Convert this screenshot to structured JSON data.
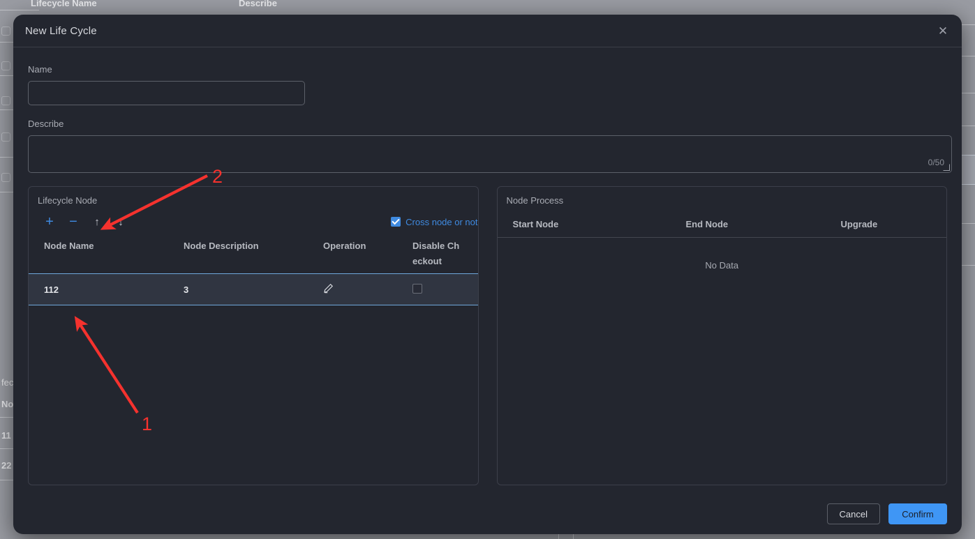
{
  "background": {
    "table_headers": [
      "Lifecycle Name",
      "Describe"
    ],
    "left_cells": [
      "fecy",
      "No",
      "11",
      "22"
    ]
  },
  "modal": {
    "title": "New Life Cycle",
    "close_icon": "close-icon",
    "fields": {
      "name_label": "Name",
      "name_value": "",
      "name_placeholder": "",
      "describe_label": "Describe",
      "describe_value": "",
      "describe_placeholder": "",
      "describe_counter": "0/50"
    },
    "left_panel": {
      "title": "Lifecycle Node",
      "toolbar": {
        "add_icon": "plus-icon",
        "add_label": "+",
        "remove_icon": "minus-icon",
        "remove_label": "−",
        "move_up_icon": "arrow-up-icon",
        "move_up_label": "↑",
        "move_down_icon": "arrow-down-icon",
        "move_down_label": "↓"
      },
      "cross_node": {
        "label": "Cross node or not",
        "checked": true
      },
      "columns": [
        "Node Name",
        "Node Description",
        "Operation",
        "Disable Ch eckout"
      ],
      "rows": [
        {
          "node_name": "112",
          "node_description": "3",
          "operation_icon": "pencil-icon",
          "disable_checkout": false,
          "selected": true
        }
      ]
    },
    "right_panel": {
      "title": "Node Process",
      "columns": [
        "Start Node",
        "End Node",
        "Upgrade"
      ],
      "empty_text": "No Data",
      "rows": []
    },
    "footer": {
      "cancel_label": "Cancel",
      "confirm_label": "Confirm"
    }
  },
  "annotations": [
    {
      "label": "1"
    },
    {
      "label": "2"
    }
  ],
  "colors": {
    "accent_blue": "#3f8ae0",
    "confirm_blue": "#3f96f5",
    "annotation_red": "#f5322e",
    "modal_bg": "#23262f",
    "row_selected_bg": "#303541",
    "row_selected_border": "#6fa8dc",
    "overlay_gray": "#9a9ca3"
  }
}
